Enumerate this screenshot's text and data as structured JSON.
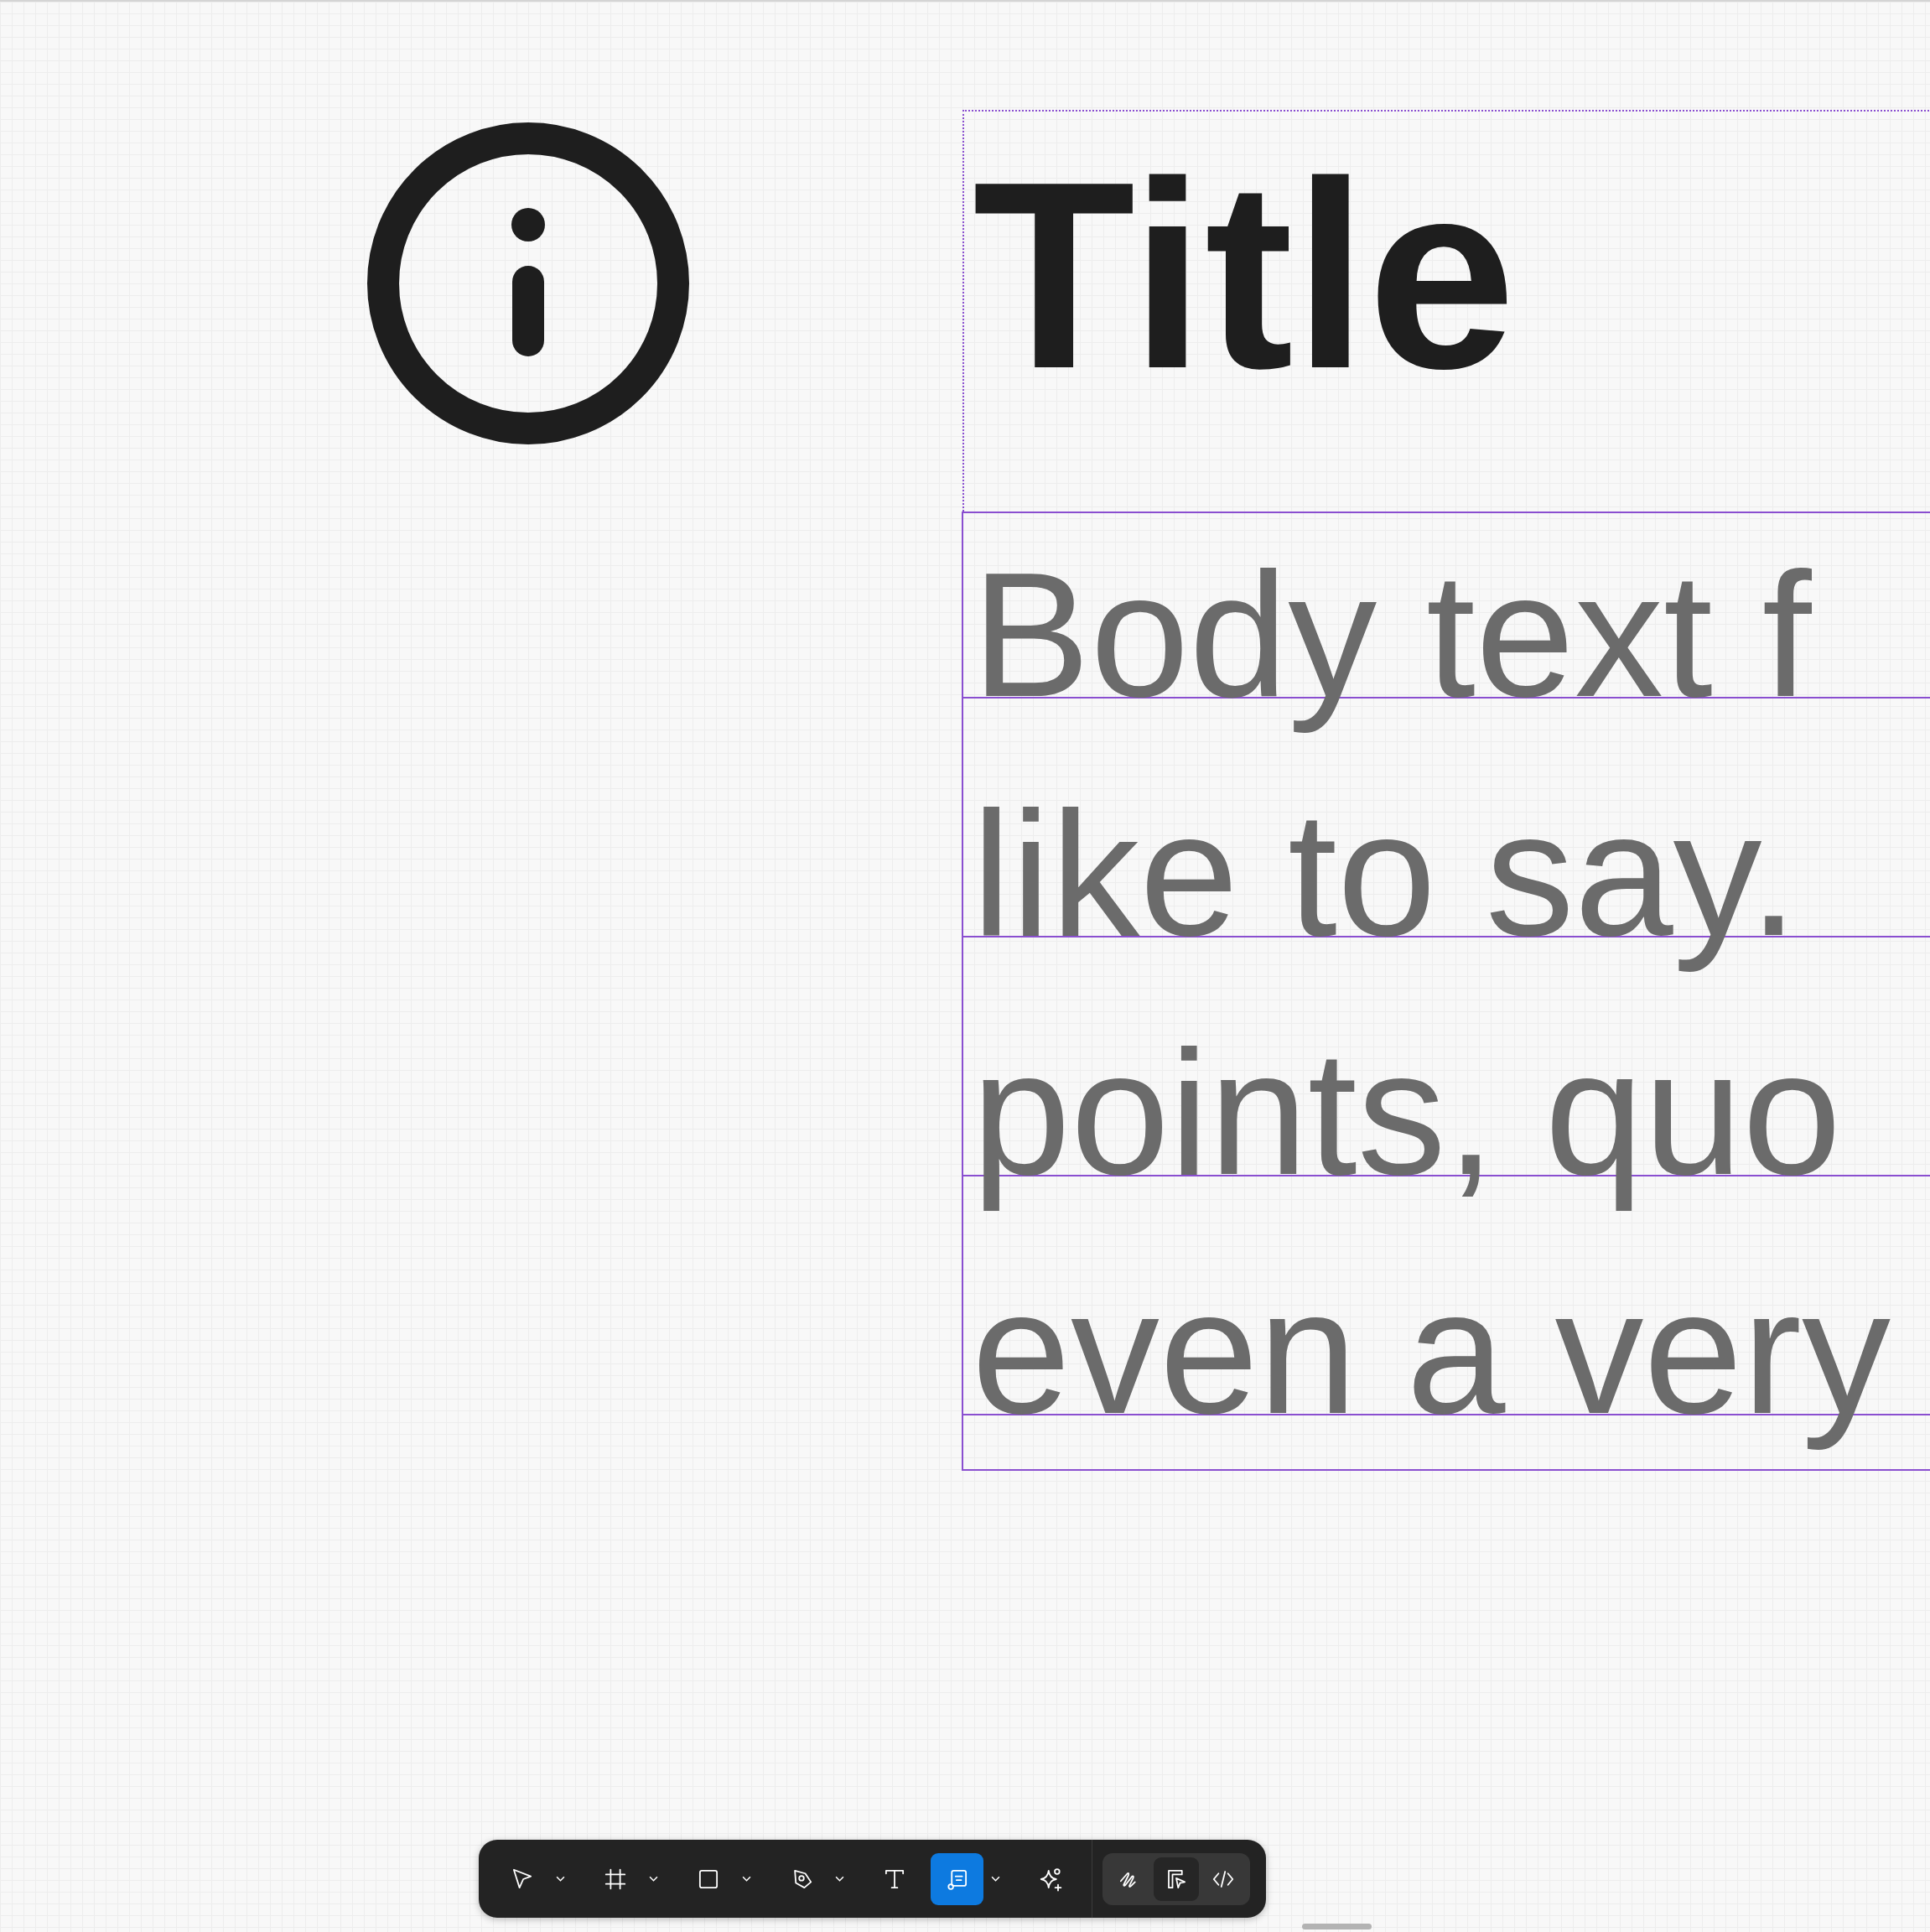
{
  "canvas": {
    "title_frame": {
      "text": "Title"
    },
    "body_frame": {
      "lines": [
        "Body text f",
        "like to say.",
        "points, quo",
        "even a very"
      ]
    }
  },
  "toolbar": {
    "tools": [
      {
        "has_menu": true,
        "selected": false
      },
      {
        "has_menu": true,
        "selected": false
      },
      {
        "has_menu": true,
        "selected": false
      },
      {
        "has_menu": true,
        "selected": false
      },
      {
        "has_menu": false,
        "selected": false
      },
      {
        "has_menu": true,
        "selected": true
      },
      {
        "has_menu": false,
        "selected": false
      }
    ],
    "modes": [
      {
        "selected": false
      },
      {
        "selected": true
      },
      {
        "selected": false
      }
    ]
  }
}
